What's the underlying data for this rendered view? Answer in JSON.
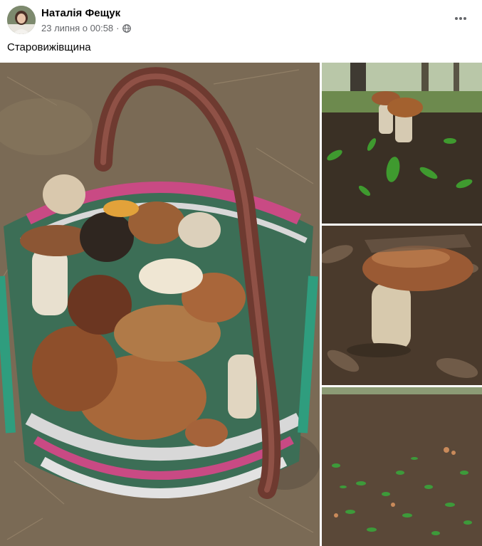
{
  "post": {
    "author": "Наталія Фещук",
    "timestamp": "23 липня о 00:58",
    "separator": "·",
    "privacy_icon": "globe-icon",
    "more_icon": "more-horizontal-icon",
    "text": "Старовижівщина"
  },
  "colors": {
    "name": "#050505",
    "meta": "#65676b",
    "background": "#ffffff"
  }
}
